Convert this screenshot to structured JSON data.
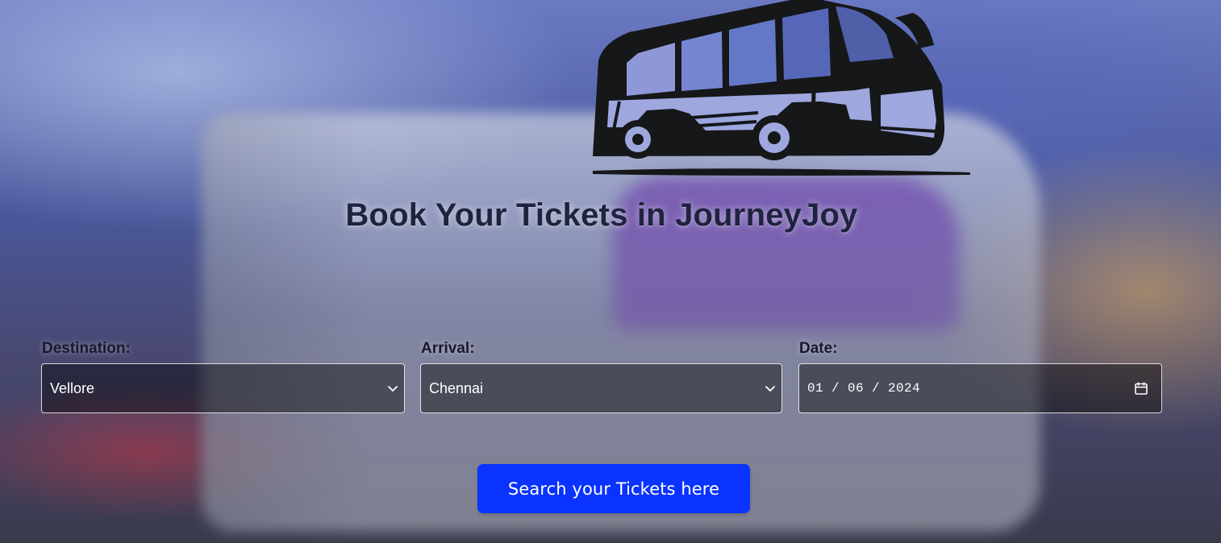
{
  "page": {
    "title": "Book Your Tickets in JourneyJoy"
  },
  "logo": {
    "icon": "bus-icon"
  },
  "form": {
    "destination": {
      "label": "Destination:",
      "value": "Vellore",
      "icon": "chevron-down-icon"
    },
    "arrival": {
      "label": "Arrival:",
      "value": "Chennai",
      "icon": "chevron-down-icon"
    },
    "date": {
      "label": "Date:",
      "value": "01 / 06 / 2024",
      "icon": "calendar-icon"
    }
  },
  "actions": {
    "search_label": "Search your Tickets here"
  },
  "colors": {
    "primary_button": "#0A33FF",
    "title_text": "#1F2340",
    "input_background": "rgba(0,0,0,0.42)"
  }
}
